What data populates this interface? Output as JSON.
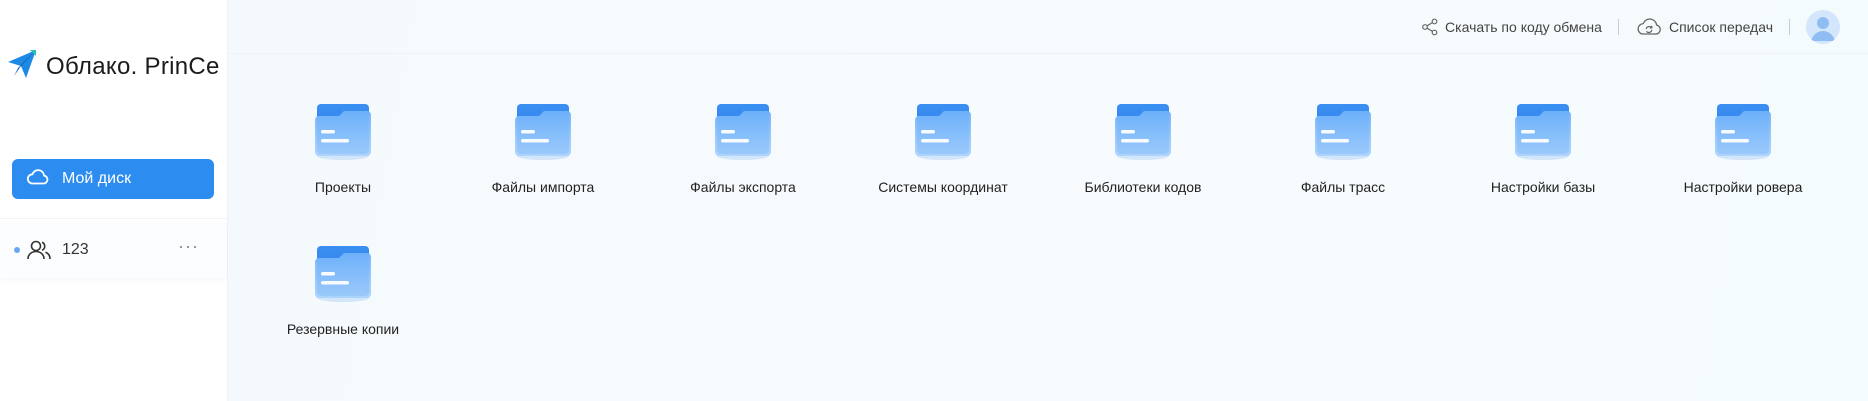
{
  "brand": {
    "name": "Облако. PrinCe",
    "logo_icon": "paper-plane-logo",
    "accent": "#2d8cf0"
  },
  "sidebar": {
    "my_disk_label": "Мой диск",
    "my_disk_icon": "cloud-icon",
    "groups": [
      {
        "label": "123",
        "icon": "users-icon",
        "more": "···"
      }
    ]
  },
  "header": {
    "download_by_code_label": "Скачать по коду обмена",
    "download_by_code_icon": "share-icon",
    "transfers_label": "Список передач",
    "transfers_icon": "cloud-sync-icon",
    "avatar_icon": "user-avatar-icon"
  },
  "folders": [
    {
      "label": "Проекты"
    },
    {
      "label": "Файлы импорта"
    },
    {
      "label": "Файлы экспорта"
    },
    {
      "label": "Системы координат"
    },
    {
      "label": "Библиотеки кодов"
    },
    {
      "label": "Файлы трасс"
    },
    {
      "label": "Настройки базы"
    },
    {
      "label": "Настройки ровера"
    },
    {
      "label": "Резервные копии"
    }
  ]
}
